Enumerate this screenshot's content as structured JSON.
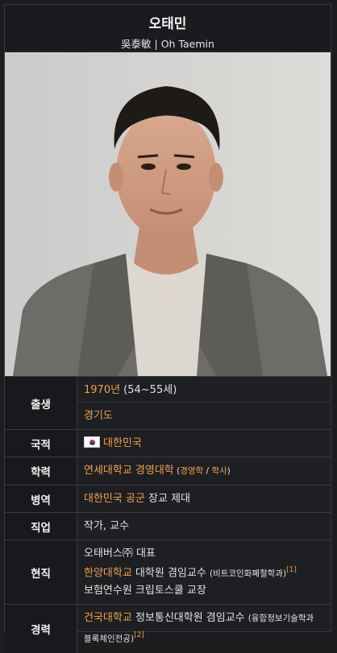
{
  "header": {
    "title": "오태민",
    "subtitle": "吳泰敏 | Oh Taemin"
  },
  "rows": {
    "birth": {
      "label": "출생",
      "year": "1970년",
      "age": " (54~55세)",
      "place": "경기도"
    },
    "nationality": {
      "label": "국적",
      "value": "대한민국"
    },
    "education": {
      "label": "학력",
      "school": "연세대학교 경영대학",
      "open": " (",
      "major": "경영학",
      "slash": " / ",
      "degree": "학사",
      "close": ")"
    },
    "military": {
      "label": "병역",
      "branch": "대한민국 공군",
      "rank": " 장교 제대"
    },
    "occupation": {
      "label": "직업",
      "value": "작가, 교수"
    },
    "current": {
      "label": "현직",
      "line1": "오태버스㈜ 대표",
      "line2_link": "한양대학교",
      "line2_text": " 대학원 겸임교수 ",
      "line2_small": "(비트코인화폐철학과)",
      "line2_ref": "[1]",
      "line3": "보험연수원 크립토스쿨 교장"
    },
    "career": {
      "label": "경력",
      "link": "건국대학교",
      "text": " 정보통신대학원 겸임교수 ",
      "small": "(융합정보기술학과 블록체인전공)",
      "ref": "[2]"
    }
  },
  "colors": {
    "link": "#f0a04b",
    "background": "#1e1f22",
    "label_bg": "#18191c"
  },
  "icons": {
    "flag": "south-korea-flag-icon"
  }
}
